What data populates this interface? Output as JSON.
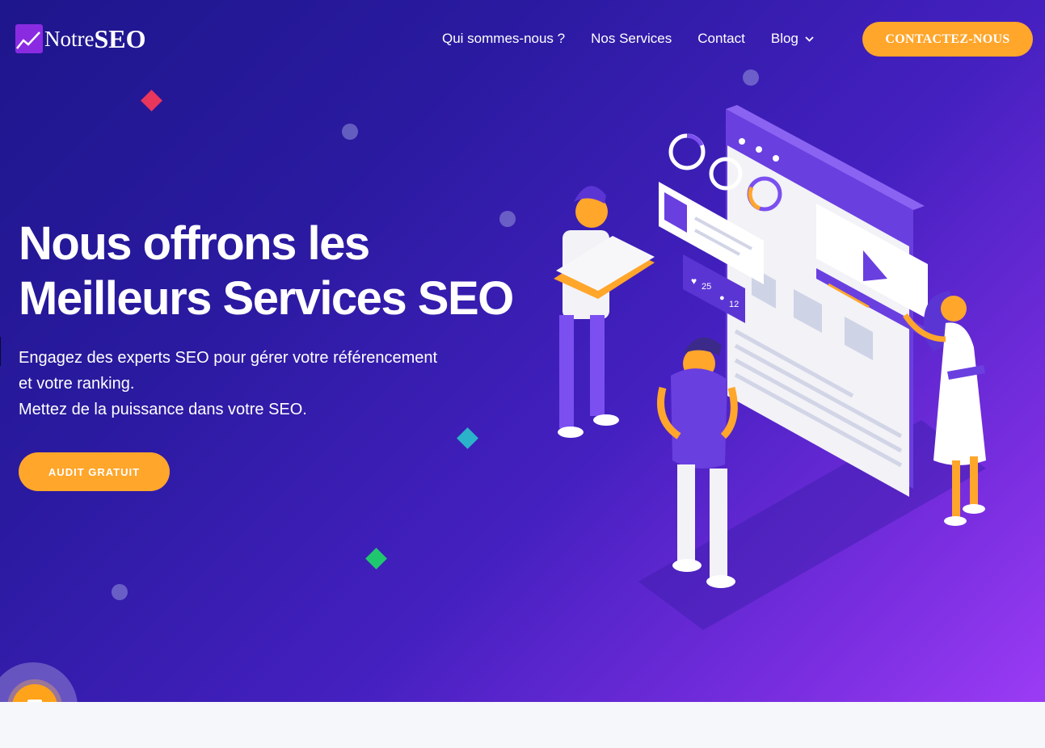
{
  "header": {
    "logo": {
      "text_light": "Notre",
      "text_bold": "SEO"
    },
    "nav": [
      {
        "label": "Qui sommes-nous ?"
      },
      {
        "label": "Nos Services"
      },
      {
        "label": "Contact"
      },
      {
        "label": "Blog",
        "has_dropdown": true
      }
    ],
    "cta_label": "CONTACTEZ-NOUS"
  },
  "hero": {
    "title_line1": "Nous offrons les",
    "title_line2": "Meilleurs Services SEO",
    "subtitle_lines": [
      "Engagez des experts SEO pour gérer votre référencement",
      "et votre ranking.",
      "Mettez de la puissance dans votre SEO."
    ],
    "cta_label": "AUDIT GRATUIT",
    "illustration": {
      "likes": "25",
      "comments": "12"
    }
  },
  "colors": {
    "accent": "#ffa62b",
    "gradient_start": "#1e168c",
    "gradient_end": "#9b3cf5",
    "diamond_red": "#e8365d",
    "diamond_cyan": "#2bb3c9",
    "diamond_green": "#1fc86e"
  },
  "icons": {
    "logo": "chart-line-icon",
    "dropdown": "chevron-down-icon",
    "chat": "message-icon"
  }
}
